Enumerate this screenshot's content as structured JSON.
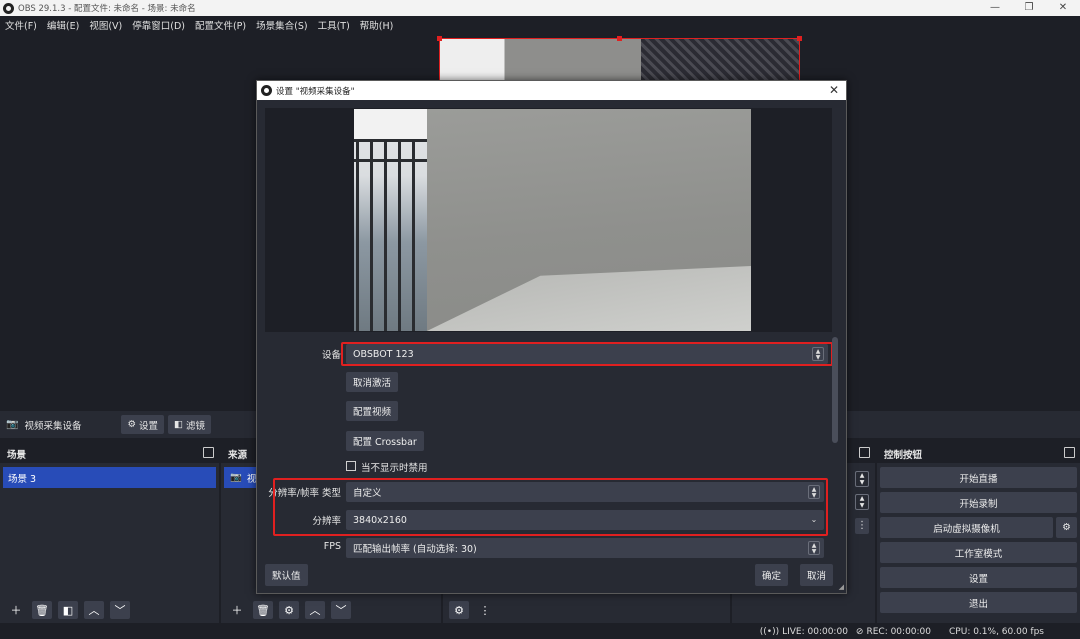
{
  "window": {
    "title": "OBS 29.1.3 - 配置文件: 未命名 - 场景: 未命名",
    "min": "—",
    "restore": "❐",
    "close": "✕"
  },
  "menu": [
    "文件(F)",
    "编辑(E)",
    "视图(V)",
    "停靠窗口(D)",
    "配置文件(P)",
    "场景集合(S)",
    "工具(T)",
    "帮助(H)"
  ],
  "source_toolbar": {
    "source_name": "视频采集设备",
    "settings": "设置",
    "filters": "滤镜"
  },
  "docks": {
    "scenes": {
      "title": "场景",
      "items": [
        "场景 3"
      ]
    },
    "sources": {
      "title": "来源",
      "items": [
        "视"
      ]
    },
    "controls": {
      "title": "控制按钮",
      "buttons": [
        "开始直播",
        "开始录制",
        "启动虚拟摄像机",
        "工作室模式",
        "设置",
        "退出"
      ]
    }
  },
  "status": {
    "live": "LIVE: 00:00:00",
    "rec": "REC: 00:00:00",
    "cpu": "CPU: 0.1%, 60.00 fps"
  },
  "dialog": {
    "title": "设置 \"视频采集设备\"",
    "device_label": "设备",
    "device_value": "OBSBOT 123",
    "deactivate": "取消激活",
    "configure_video": "配置视频",
    "configure_crossbar": "配置 Crossbar",
    "disable_when_hidden": "当不显示时禁用",
    "res_type_label": "分辨率/帧率 类型",
    "res_type_value": "自定义",
    "resolution_label": "分辨率",
    "resolution_value": "3840x2160",
    "fps_label": "FPS",
    "fps_value": "匹配输出帧率 (自动选择: 30)",
    "defaults": "默认值",
    "ok": "确定",
    "cancel": "取消"
  },
  "colors": {
    "accent": "#284cb8",
    "highlight": "#e02020",
    "panel": "#272a33",
    "background": "#1d1f26"
  }
}
